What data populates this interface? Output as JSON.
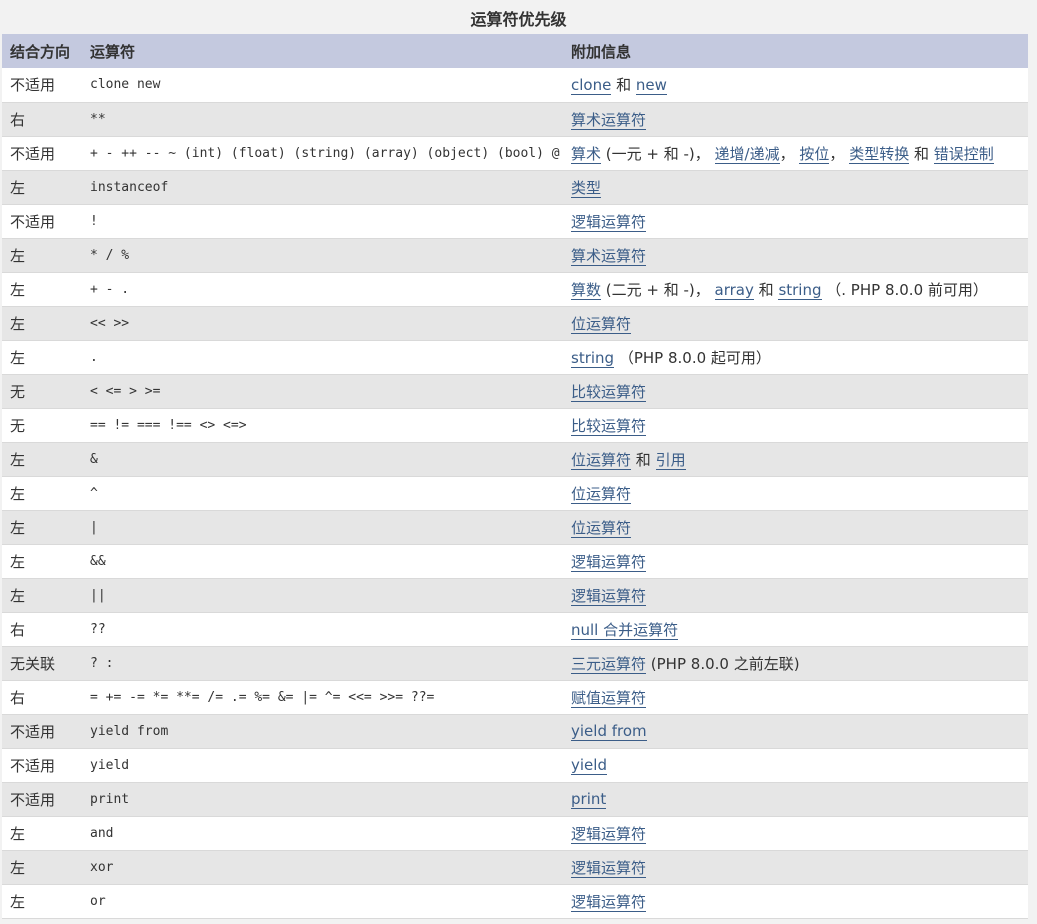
{
  "caption": "运算符优先级",
  "headers": [
    "结合方向",
    "运算符",
    "附加信息"
  ],
  "rows": [
    {
      "assoc": "不适用",
      "ops": "clone new",
      "info": [
        {
          "t": "clone",
          "link": true
        },
        {
          "t": " 和 ",
          "link": false
        },
        {
          "t": "new",
          "link": true
        }
      ]
    },
    {
      "assoc": "右",
      "ops": "**",
      "info": [
        {
          "t": "算术运算符",
          "link": true
        }
      ]
    },
    {
      "assoc": "不适用",
      "ops": "+ - ++ -- ~ (int) (float) (string) (array) (object) (bool) @",
      "info": [
        {
          "t": "算术",
          "link": true
        },
        {
          "t": " (一元 + 和 -)， ",
          "link": false
        },
        {
          "t": "递增/递减",
          "link": true
        },
        {
          "t": "， ",
          "link": false
        },
        {
          "t": "按位",
          "link": true
        },
        {
          "t": "， ",
          "link": false
        },
        {
          "t": "类型转换",
          "link": true
        },
        {
          "t": " 和 ",
          "link": false
        },
        {
          "t": "错误控制",
          "link": true
        }
      ]
    },
    {
      "assoc": "左",
      "ops": "instanceof",
      "info": [
        {
          "t": "类型",
          "link": true
        }
      ]
    },
    {
      "assoc": "不适用",
      "ops": "!",
      "info": [
        {
          "t": "逻辑运算符",
          "link": true
        }
      ]
    },
    {
      "assoc": "左",
      "ops": "* / %",
      "info": [
        {
          "t": "算术运算符",
          "link": true
        }
      ]
    },
    {
      "assoc": "左",
      "ops": "+ - .",
      "info": [
        {
          "t": "算数",
          "link": true
        },
        {
          "t": " (二元 + 和 -)， ",
          "link": false
        },
        {
          "t": "array",
          "link": true
        },
        {
          "t": " 和 ",
          "link": false
        },
        {
          "t": "string",
          "link": true
        },
        {
          "t": " （. PHP 8.0.0 前可用）",
          "link": false
        }
      ]
    },
    {
      "assoc": "左",
      "ops": "<< >>",
      "info": [
        {
          "t": "位运算符",
          "link": true
        }
      ]
    },
    {
      "assoc": "左",
      "ops": ".",
      "info": [
        {
          "t": "string",
          "link": true
        },
        {
          "t": " （PHP 8.0.0 起可用）",
          "link": false
        }
      ]
    },
    {
      "assoc": "无",
      "ops": "< <= > >=",
      "info": [
        {
          "t": "比较运算符",
          "link": true
        }
      ]
    },
    {
      "assoc": "无",
      "ops": "== != === !== <> <=>",
      "info": [
        {
          "t": "比较运算符",
          "link": true
        }
      ]
    },
    {
      "assoc": "左",
      "ops": "&",
      "info": [
        {
          "t": "位运算符",
          "link": true
        },
        {
          "t": " 和 ",
          "link": false
        },
        {
          "t": "引用",
          "link": true
        }
      ]
    },
    {
      "assoc": "左",
      "ops": "^",
      "info": [
        {
          "t": "位运算符",
          "link": true
        }
      ]
    },
    {
      "assoc": "左",
      "ops": "|",
      "info": [
        {
          "t": "位运算符",
          "link": true
        }
      ]
    },
    {
      "assoc": "左",
      "ops": "&&",
      "info": [
        {
          "t": "逻辑运算符",
          "link": true
        }
      ]
    },
    {
      "assoc": "左",
      "ops": "||",
      "info": [
        {
          "t": "逻辑运算符",
          "link": true
        }
      ]
    },
    {
      "assoc": "右",
      "ops": "??",
      "info": [
        {
          "t": "null 合并运算符",
          "link": true
        }
      ]
    },
    {
      "assoc": "无关联",
      "ops": "? :",
      "info": [
        {
          "t": "三元运算符",
          "link": true
        },
        {
          "t": " (PHP 8.0.0 之前左联)",
          "link": false
        }
      ]
    },
    {
      "assoc": "右",
      "ops": "= += -= *= **= /= .= %= &= |= ^= <<= >>= ??=",
      "info": [
        {
          "t": "赋值运算符",
          "link": true
        }
      ]
    },
    {
      "assoc": "不适用",
      "ops": "yield from",
      "info": [
        {
          "t": "yield from",
          "link": true
        }
      ]
    },
    {
      "assoc": "不适用",
      "ops": "yield",
      "info": [
        {
          "t": "yield",
          "link": true
        }
      ]
    },
    {
      "assoc": "不适用",
      "ops": "print",
      "info": [
        {
          "t": "print",
          "link": true
        }
      ]
    },
    {
      "assoc": "左",
      "ops": "and",
      "info": [
        {
          "t": "逻辑运算符",
          "link": true
        }
      ]
    },
    {
      "assoc": "左",
      "ops": "xor",
      "info": [
        {
          "t": "逻辑运算符",
          "link": true
        }
      ]
    },
    {
      "assoc": "左",
      "ops": "or",
      "info": [
        {
          "t": "逻辑运算符",
          "link": true
        }
      ]
    }
  ]
}
